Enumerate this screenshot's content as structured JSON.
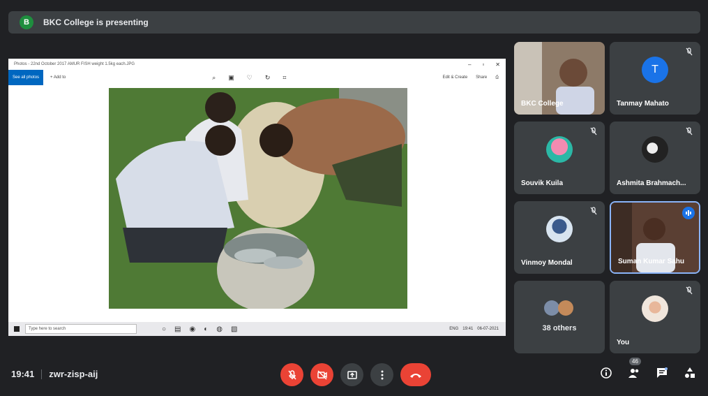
{
  "banner": {
    "badge": "B",
    "text": "BKC College is presenting"
  },
  "share": {
    "window_title": "Photos - 22nd October 2017 AMUR FISH weight 1.5kg each.JPG",
    "see_all": "See all photos",
    "add_to": "+ Add to",
    "edit_create": "Edit & Create",
    "share_label": "Share",
    "taskbar_search": "Type here to search",
    "tray_lang": "ENG",
    "tray_time": "19:41",
    "tray_date": "06-07-2021"
  },
  "participants": [
    {
      "name": "BKC College",
      "kind": "video"
    },
    {
      "name": "Tanmay Mahato",
      "kind": "letter",
      "letter": "T",
      "muted": true
    },
    {
      "name": "Souvik Kuila",
      "kind": "photo",
      "muted": true
    },
    {
      "name": "Ashmita Brahmach...",
      "kind": "photo",
      "muted": true
    },
    {
      "name": "Vinmoy Mondal",
      "kind": "photo",
      "muted": true
    },
    {
      "name": "Suman Kumar Sahu",
      "kind": "video",
      "speaking": true
    },
    {
      "name": "38 others",
      "kind": "group"
    },
    {
      "name": "You",
      "kind": "photo",
      "muted": true
    }
  ],
  "bottom": {
    "time": "19:41",
    "meeting_code": "zwr-zisp-aij",
    "participant_count": "46"
  },
  "colors": {
    "accent": "#1a73e8",
    "danger": "#ea4335",
    "tile": "#3c4043",
    "bg": "#202124"
  }
}
